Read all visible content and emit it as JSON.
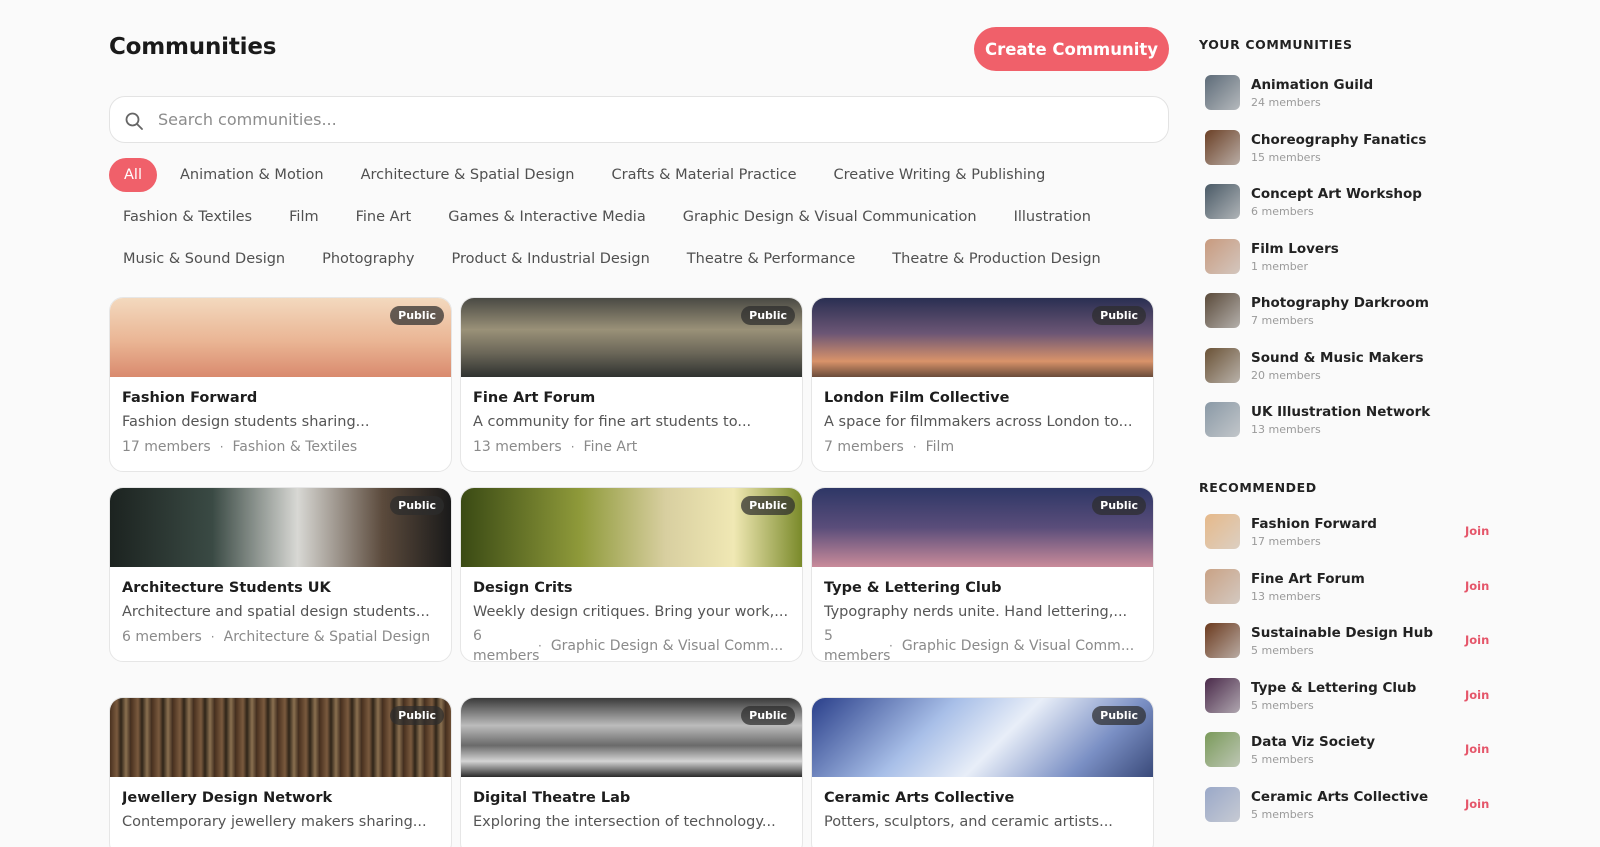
{
  "header": {
    "title": "Communities",
    "create_label": "Create Community"
  },
  "search": {
    "placeholder": "Search communities..."
  },
  "filters": [
    [
      "All",
      "Animation & Motion",
      "Architecture & Spatial Design",
      "Crafts & Material Practice",
      "Creative Writing & Publishing"
    ],
    [
      "Fashion & Textiles",
      "Film",
      "Fine Art",
      "Games & Interactive Media",
      "Graphic Design & Visual Communication",
      "Illustration"
    ],
    [
      "Music & Sound Design",
      "Photography",
      "Product & Industrial Design",
      "Theatre & Performance",
      "Theatre & Production Design"
    ]
  ],
  "active_filter": "All",
  "cards": [
    {
      "title": "Fashion Forward",
      "desc": "Fashion design students sharing...",
      "members": "17 members",
      "category": "Fashion & Textiles",
      "badge": "Public",
      "image": "golden-gate-bridge"
    },
    {
      "title": "Fine Art Forum",
      "desc": "A community for fine art students to...",
      "members": "13 members",
      "category": "Fine Art",
      "badge": "Public",
      "image": "stormy-sea"
    },
    {
      "title": "London Film Collective",
      "desc": "A space for filmmakers across London to...",
      "members": "7 members",
      "category": "Film",
      "badge": "Public",
      "image": "sunset-sky"
    },
    {
      "title": "Architecture Students UK",
      "desc": "Architecture and spatial design students...",
      "members": "6 members",
      "category": "Architecture & Spatial Design",
      "badge": "Public",
      "image": "coffee-brewing"
    },
    {
      "title": "Design Crits",
      "desc": "Weekly design critiques. Bring your work,...",
      "members": "6 members",
      "category": "Graphic Design & Visual Comm...",
      "badge": "Public",
      "image": "mushroom"
    },
    {
      "title": "Type & Lettering Club",
      "desc": "Typography nerds unite. Hand lettering,...",
      "members": "5 members",
      "category": "Graphic Design & Visual Comm...",
      "badge": "Public",
      "image": "dusk-sky"
    },
    {
      "title": "Jewellery Design Network",
      "desc": "Contemporary jewellery makers sharing...",
      "members": "",
      "category": "",
      "badge": "Public",
      "image": "forest"
    },
    {
      "title": "Digital Theatre Lab",
      "desc": "Exploring the intersection of technology...",
      "members": "",
      "category": "",
      "badge": "Public",
      "image": "motion-blur-screen"
    },
    {
      "title": "Ceramic Arts Collective",
      "desc": "Potters, sculptors, and ceramic artists...",
      "members": "",
      "category": "",
      "badge": "Public",
      "image": "stage-lights"
    }
  ],
  "sidebar": {
    "yours_heading": "YOUR COMMUNITIES",
    "yours": [
      {
        "name": "Animation Guild",
        "members": "24 members",
        "thumb": "#5d6b78"
      },
      {
        "name": "Choreography Fanatics",
        "members": "15 members",
        "thumb": "#6b4026"
      },
      {
        "name": "Concept Art Workshop",
        "members": "6 members",
        "thumb": "#4a5a66"
      },
      {
        "name": "Film Lovers",
        "members": "1 member",
        "thumb": "#c89a7e"
      },
      {
        "name": "Photography Darkroom",
        "members": "7 members",
        "thumb": "#5a4a3a"
      },
      {
        "name": "Sound & Music Makers",
        "members": "20 members",
        "thumb": "#6a5236"
      },
      {
        "name": "UK Illustration Network",
        "members": "13 members",
        "thumb": "#8a99a6"
      }
    ],
    "recommended_heading": "RECOMMENDED",
    "join_label": "Join",
    "recommended": [
      {
        "name": "Fashion Forward",
        "members": "17 members",
        "thumb": "#e6b98a"
      },
      {
        "name": "Fine Art Forum",
        "members": "13 members",
        "thumb": "#c9a285"
      },
      {
        "name": "Sustainable Design Hub",
        "members": "5 members",
        "thumb": "#6b3a1e"
      },
      {
        "name": "Type & Lettering Club",
        "members": "5 members",
        "thumb": "#4a2a4a"
      },
      {
        "name": "Data Viz Society",
        "members": "5 members",
        "thumb": "#7a9a5a"
      },
      {
        "name": "Ceramic Arts Collective",
        "members": "5 members",
        "thumb": "#9aa8c8"
      }
    ]
  }
}
